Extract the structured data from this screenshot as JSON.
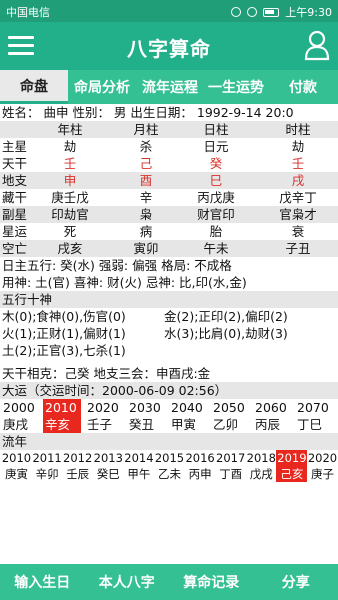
{
  "status_bar": {
    "carrier": "中国电信",
    "time": "上午9:30"
  },
  "header": {
    "title": "八字算命"
  },
  "tabs": [
    "命盘",
    "命局分析",
    "流年运程",
    "一生运势",
    "付款"
  ],
  "info_line": "姓名：  曲申  性别：  男  出生日期：  1992-9-14 20:0",
  "pillar_headers": [
    "年柱",
    "月柱",
    "日柱",
    "时柱"
  ],
  "rows": [
    {
      "label": "主星",
      "cells": [
        "劫",
        "杀",
        "日元",
        "劫"
      ],
      "gray": true
    },
    {
      "label": "天干",
      "cells": [
        "壬",
        "己",
        "癸",
        "壬"
      ],
      "red": true
    },
    {
      "label": "地支",
      "cells": [
        "申",
        "酉",
        "巳",
        "戌"
      ],
      "red": true,
      "gray": true
    },
    {
      "label": "藏干",
      "cells": [
        "庚壬戊",
        "辛",
        "丙戊庚",
        "戊辛丁"
      ]
    },
    {
      "label": "副星",
      "cells": [
        "印劫官",
        "枭",
        "财官印",
        "官枭才"
      ],
      "gray": true
    },
    {
      "label": "星运",
      "cells": [
        "死",
        "病",
        "胎",
        "衰"
      ]
    },
    {
      "label": "空亡",
      "cells": [
        "戌亥",
        "寅卯",
        "午未",
        "子丑"
      ],
      "gray": true
    }
  ],
  "wuxing_line": "日主五行:  癸(水)  强弱:  偏强      格局:  不成格",
  "yongshen_line": "用神:      土(官)  喜神:  财(火)  忌神:  比,印(水,金)",
  "wuxing_title": "五行十神",
  "shishen_rows": [
    [
      "木(0);食神(0),伤官(0)",
      "金(2);正印(2),偏印(2)"
    ],
    [
      "火(1);正财(1),偏财(1)",
      "水(3);比肩(0),劫财(3)"
    ],
    [
      "土(2);正官(3),七杀(1)",
      ""
    ]
  ],
  "relation_line": "天干相克：己癸  地支三会：申酉戌:金",
  "dayun_title": "大运（交运时间：2000-06-09 02:56）",
  "dayun_years": [
    "2000",
    "2010",
    "2020",
    "2030",
    "2040",
    "2050",
    "2060",
    "2070"
  ],
  "dayun_gz": [
    "庚戌",
    "辛亥",
    "壬子",
    "癸丑",
    "甲寅",
    "乙卯",
    "丙辰",
    "丁巳"
  ],
  "dayun_highlight": 1,
  "liunian_title": "流年",
  "liunian_years": [
    "2010",
    "2011",
    "2012",
    "2013",
    "2014",
    "2015",
    "2016",
    "2017",
    "2018",
    "2019",
    "2020"
  ],
  "liunian_gz": [
    "庚寅",
    "辛卯",
    "壬辰",
    "癸巳",
    "甲午",
    "乙未",
    "丙申",
    "丁酉",
    "戊戌",
    "己亥",
    "庚子"
  ],
  "liunian_highlight": 9,
  "bottom_nav": [
    "输入生日",
    "本人八字",
    "算命记录",
    "分享"
  ],
  "colors": {
    "header": "#22b08a",
    "tabs": "#35c093",
    "highlight": "#e8271e",
    "text_red": "#d9312c"
  }
}
